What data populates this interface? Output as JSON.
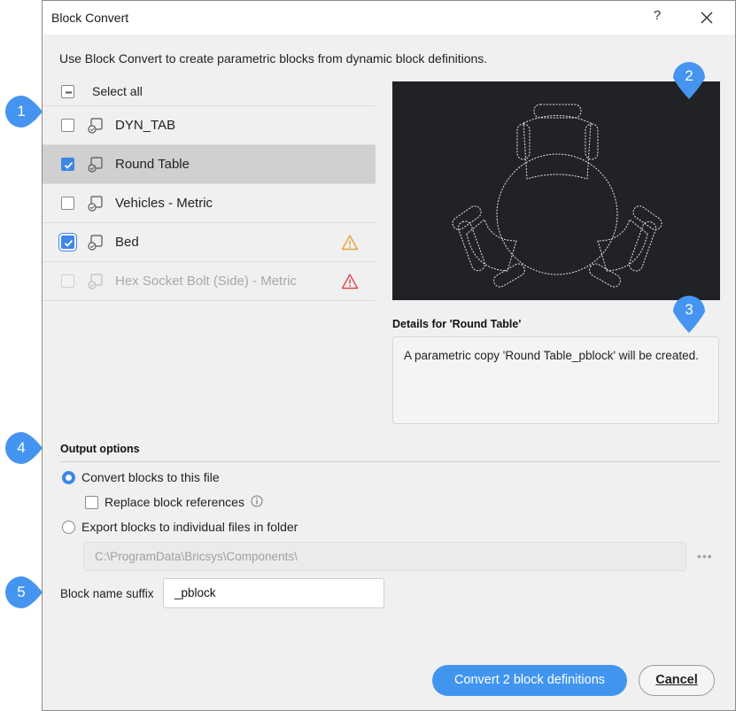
{
  "window": {
    "title": "Block Convert",
    "help_label": "?"
  },
  "intro_text": "Use Block Convert to create parametric blocks from dynamic block definitions.",
  "list": {
    "select_all_label": "Select all",
    "select_all_state": "indeterminate",
    "items": [
      {
        "label": "DYN_TAB",
        "checked": false,
        "selected": false,
        "disabled": false,
        "warning": "none"
      },
      {
        "label": "Round Table",
        "checked": true,
        "selected": true,
        "disabled": false,
        "warning": "none"
      },
      {
        "label": "Vehicles - Metric",
        "checked": false,
        "selected": false,
        "disabled": false,
        "warning": "none"
      },
      {
        "label": "Bed",
        "checked": true,
        "selected": false,
        "disabled": false,
        "warning": "warning-icon"
      },
      {
        "label": "Hex Socket Bolt (Side) - Metric",
        "checked": false,
        "selected": false,
        "disabled": true,
        "warning": "error-icon"
      }
    ]
  },
  "details": {
    "label": "Details for 'Round Table'",
    "text": "A parametric copy 'Round Table_pblock' will be created."
  },
  "output_options": {
    "header": "Output options",
    "convert_label": "Convert blocks to this file",
    "convert_selected": true,
    "replace_refs_label": "Replace block references",
    "replace_refs_checked": false,
    "export_label": "Export blocks to individual files in folder",
    "export_selected": false,
    "folder_path": "C:\\ProgramData\\Bricsys\\Components\\",
    "browse_label": "•••"
  },
  "suffix": {
    "label": "Block name suffix",
    "value": "_pblock"
  },
  "buttons": {
    "convert_label": "Convert 2 block definitions",
    "cancel_label": "Cancel"
  },
  "callouts": [
    "1",
    "2",
    "3",
    "4",
    "5"
  ],
  "colors": {
    "accent": "#3e86e8",
    "callout": "#4595f0",
    "warning": "#e8a33a",
    "error": "#e04848",
    "preview_bg": "#212226"
  }
}
